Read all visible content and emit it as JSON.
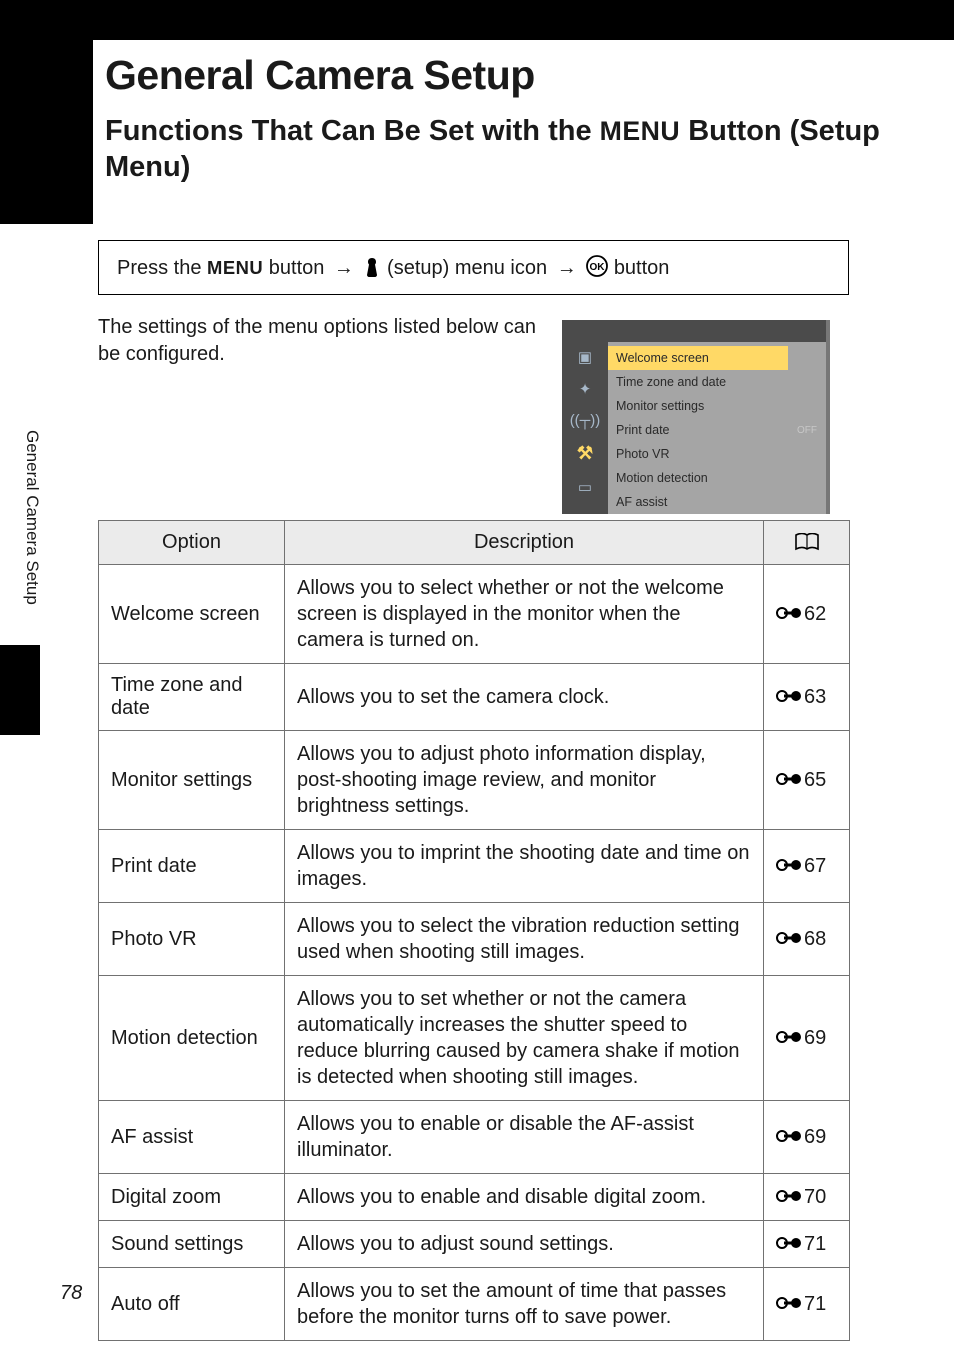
{
  "page": {
    "number": "78",
    "side_label": "General Camera Setup",
    "title": "General Camera Setup",
    "section_title_pre": "Functions That Can Be Set with the ",
    "section_title_menu": "MENU",
    "section_title_post": " Button (Setup Menu)"
  },
  "instruction": {
    "prefix": "Press the ",
    "menu_label": "MENU",
    "word_button": " button ",
    "setup_text": " (setup) menu icon ",
    "ok_text": " button"
  },
  "intro_text": "The settings of the menu options listed below can be configured.",
  "mini_menu": {
    "items": [
      "Welcome screen",
      "Time zone and date",
      "Monitor settings",
      "Print date",
      "Photo VR",
      "Motion detection",
      "AF assist"
    ],
    "values": [
      "OFF",
      "",
      ""
    ],
    "highlight_index": 0
  },
  "table": {
    "headers": {
      "option": "Option",
      "description": "Description"
    },
    "ref_prefix": "🔗",
    "rows": [
      {
        "option": "Welcome screen",
        "description": "Allows you to select whether or not the welcome screen is displayed in the monitor when the camera is turned on.",
        "ref": "62"
      },
      {
        "option": "Time zone and date",
        "description": "Allows you to set the camera clock.",
        "ref": "63"
      },
      {
        "option": "Monitor settings",
        "description": "Allows you to adjust photo information display, post-shooting image review, and monitor brightness settings.",
        "ref": "65"
      },
      {
        "option": "Print date",
        "description": "Allows you to imprint the shooting date and time on images.",
        "ref": "67"
      },
      {
        "option": "Photo VR",
        "description": "Allows you to select the vibration reduction setting used when shooting still images.",
        "ref": "68"
      },
      {
        "option": "Motion detection",
        "description": "Allows you to set whether or not the camera automatically increases the shutter speed to reduce blurring caused by camera shake if motion is detected when shooting still images.",
        "ref": "69"
      },
      {
        "option": "AF assist",
        "description": "Allows you to enable or disable the AF-assist illuminator.",
        "ref": "69"
      },
      {
        "option": "Digital zoom",
        "description": "Allows you to enable and disable digital zoom.",
        "ref": "70"
      },
      {
        "option": "Sound settings",
        "description": "Allows you to adjust sound settings.",
        "ref": "71"
      },
      {
        "option": "Auto off",
        "description": "Allows you to set the amount of time that passes before the monitor turns off to save power.",
        "ref": "71"
      }
    ]
  }
}
